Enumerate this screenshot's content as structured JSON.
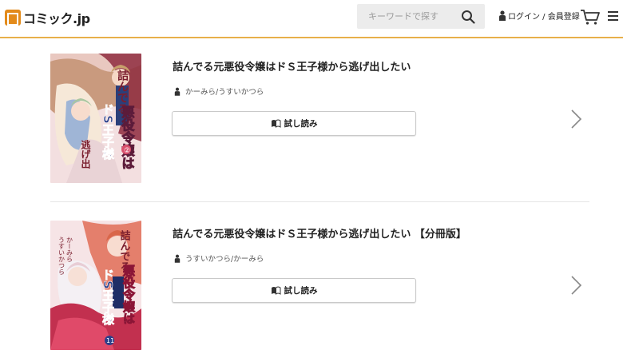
{
  "header": {
    "logo_text": "コミック.jp",
    "search_placeholder": "キーワードで探す",
    "login_label": "ログイン / 会員登録",
    "accent_color": "#e8b04a"
  },
  "items": [
    {
      "title": "詰んでる元悪役令嬢はドＳ王子様から逃げ出したい",
      "author": "かーみら/うすいかつら",
      "read_label": "試し読み",
      "cover_title": "詰んでる元悪役令嬢はドS王子様から逃げ出したい"
    },
    {
      "title": "詰んでる元悪役令嬢はドＳ王子様から逃げ出したい 【分冊版】",
      "author": "うすいかつら/かーみら",
      "read_label": "試し読み",
      "cover_title": "詰んでる元悪役令嬢はドS王子様から逃げ出したい 分冊版"
    }
  ],
  "icons": {
    "logo": "comic-jp-logo-icon",
    "search": "search-icon",
    "person": "person-icon",
    "cart": "cart-icon",
    "menu": "menu-icon",
    "book": "book-icon",
    "chevron": "chevron-right-icon"
  }
}
